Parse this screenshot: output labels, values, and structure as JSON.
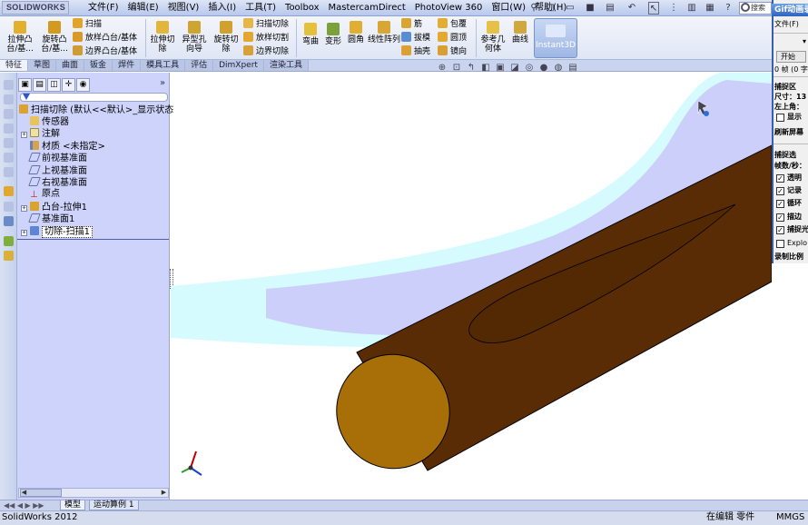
{
  "app": {
    "logo": "SOLIDWORKS",
    "status_app": "SolidWorks 2012",
    "status_mode": "在编辑 零件",
    "status_units": "MMGS"
  },
  "menu": [
    "文件(F)",
    "编辑(E)",
    "视图(V)",
    "插入(I)",
    "工具(T)",
    "Toolbox",
    "MastercamDirect",
    "PhotoView 360",
    "窗口(W)",
    "帮助(H)"
  ],
  "search_label": "搜索",
  "commands": {
    "extrude_boss": "拉伸凸台/基...",
    "revolve_boss": "旋转凸台/基...",
    "sweep": "扫描",
    "loft": "放样凸台/基体",
    "boundary": "边界凸台/基体",
    "extrude_cut": "拉伸切除",
    "hole_wizard": "异型孔向导",
    "revolve_cut": "旋转切除",
    "swept_cut": "扫描切除",
    "lofted_cut": "放样切割",
    "boundary_cut": "边界切除",
    "flex": "弯曲",
    "deform": "变形",
    "fillet": "圆角",
    "linear_pattern": "线性阵列",
    "rib": "筋",
    "draft": "拔模",
    "shell": "抽壳",
    "wrap": "包覆",
    "dome": "圆顶",
    "mirror": "镜向",
    "reference_geometry": "参考几何体",
    "curves": "曲线",
    "instant3d": "Instant3D"
  },
  "tabs": [
    "特征",
    "草图",
    "曲面",
    "钣金",
    "焊件",
    "模具工具",
    "评估",
    "DimXpert",
    "渲染工具"
  ],
  "tree": {
    "root": "扫描切除  (默认<<默认>_显示状态",
    "items": [
      "传感器",
      "注解",
      "材质 <未指定>",
      "前视基准面",
      "上视基准面",
      "右视基准面",
      "原点",
      "凸台-拉伸1",
      "基准面1",
      "切除-扫描1"
    ]
  },
  "bottom_tabs": [
    "模型",
    "运动算例 1"
  ],
  "gif": {
    "title": "Gif动画录制",
    "menu": "文件(F)",
    "start_button": "开始",
    "frames": "0 帧 (0 字",
    "capture_region": "捕捉区",
    "size_label": "尺寸：13",
    "top_left": "左上角：",
    "show_label": "显示",
    "refresh_label": "刷新屏幕",
    "capture_opts": "捕捉选",
    "fps_label": "帧数/秒：",
    "checks": [
      "透明",
      "记录",
      "循环",
      "描边",
      "捕捉光",
      "Explo"
    ],
    "checked": [
      true,
      true,
      true,
      true,
      true,
      false
    ],
    "ratio_label": "录制比例"
  },
  "colors": {
    "rod_side": "#5a2c06",
    "rod_cap": "#a86f08",
    "cyan_band": "#d6fbff",
    "lavender": "#cccff9",
    "panel_bg": "#cdd3fa"
  }
}
